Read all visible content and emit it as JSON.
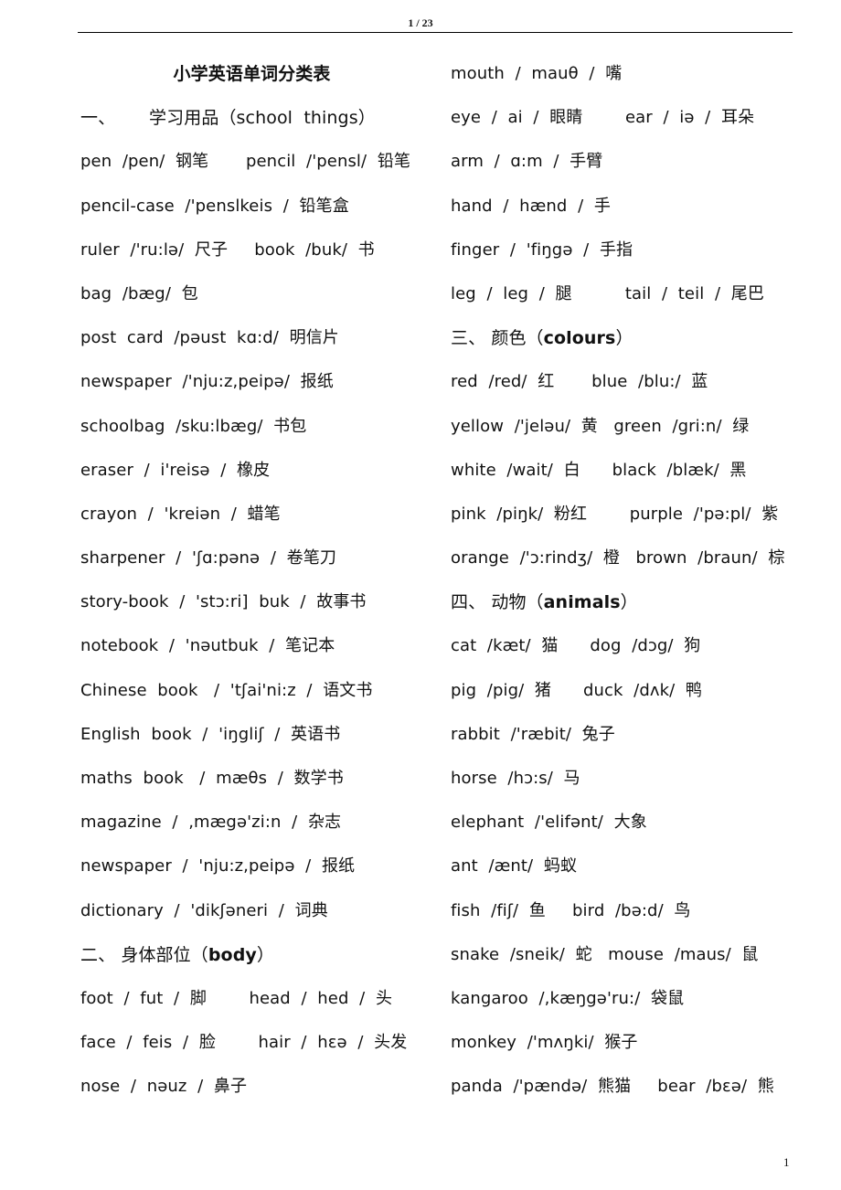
{
  "header": {
    "page_indicator": "1 / 23"
  },
  "footer": {
    "page_number": "1"
  },
  "left_column": [
    {
      "type": "title",
      "text": "小学英语单词分类表"
    },
    {
      "type": "heading",
      "prefix": "一、      学习用品（",
      "en": "school  things",
      "suffix": "）",
      "bold_en": false
    },
    {
      "type": "entry",
      "text": "pen  /pen/  钢笔       pencil  /'pensl/  铅笔"
    },
    {
      "type": "entry",
      "text": "pencil-case  /'penslkeis  /  铅笔盒"
    },
    {
      "type": "entry",
      "text": "ruler  /'ru:lə/  尺子     book  /buk/  书"
    },
    {
      "type": "entry",
      "text": "bag  /bæg/  包"
    },
    {
      "type": "entry",
      "text": "post  card  /pəust  kɑ:d/  明信片"
    },
    {
      "type": "entry",
      "text": "newspaper  /'nju:z,peipə/  报纸"
    },
    {
      "type": "entry",
      "text": "schoolbag  /sku:lbæg/  书包"
    },
    {
      "type": "entry",
      "text": "eraser  /  i'reisə  /  橡皮"
    },
    {
      "type": "entry",
      "text": "crayon  /  'kreiən  /  蜡笔"
    },
    {
      "type": "entry",
      "text": "sharpener  /  'ʃɑ:pənə  /  卷笔刀"
    },
    {
      "type": "entry",
      "text": "story-book  /  'stɔ:ri]  buk  /  故事书"
    },
    {
      "type": "entry",
      "text": "notebook  /  'nəutbuk  /  笔记本"
    },
    {
      "type": "entry",
      "text": "Chinese  book   /  'tʃai'ni:z  /  语文书"
    },
    {
      "type": "entry",
      "text": "English  book  /  'iŋgliʃ  /  英语书"
    },
    {
      "type": "entry",
      "text": "maths  book   /  mæθs  /  数学书"
    },
    {
      "type": "entry",
      "text": "magazine  /  ,mægə'zi:n  /  杂志"
    },
    {
      "type": "entry",
      "text": "newspaper  /  'nju:z,peipə  /  报纸"
    },
    {
      "type": "entry",
      "text": "dictionary  /  'dikʃəneri  /  词典"
    },
    {
      "type": "heading",
      "prefix": "二、 身体部位（",
      "en": "body",
      "suffix": "）",
      "bold_en": true
    },
    {
      "type": "entry",
      "text": "foot  /  fut  /  脚        head  /  hed  /  头"
    },
    {
      "type": "entry",
      "text": "face  /  feis  /  脸        hair  /  hɛə  /  头发"
    },
    {
      "type": "entry",
      "text": "nose  /  nəuz  /  鼻子"
    }
  ],
  "right_column": [
    {
      "type": "entry",
      "text": "mouth  /  mauθ  /  嘴"
    },
    {
      "type": "entry",
      "text": "eye  /  ai  /  眼睛        ear  /  iə  /  耳朵"
    },
    {
      "type": "entry",
      "text": "arm  /  ɑ:m  /  手臂"
    },
    {
      "type": "entry",
      "text": "hand  /  hænd  /  手"
    },
    {
      "type": "entry",
      "text": "finger  /  'fiŋgə  /  手指"
    },
    {
      "type": "entry",
      "text": "leg  /  leg  /  腿          tail  /  teil  /  尾巴"
    },
    {
      "type": "heading",
      "prefix": "三、 颜色（",
      "en": "colours",
      "suffix": "）",
      "bold_en": true
    },
    {
      "type": "entry",
      "text": "red  /red/  红       blue  /blu:/  蓝"
    },
    {
      "type": "entry",
      "text": "yellow  /'jeləu/  黄   green  /gri:n/  绿"
    },
    {
      "type": "entry",
      "text": "white  /wait/  白      black  /blæk/  黑"
    },
    {
      "type": "entry",
      "text": "pink  /piŋk/  粉红        purple  /'pə:pl/  紫"
    },
    {
      "type": "entry",
      "text": "orange  /'ɔ:rindʒ/  橙   brown  /braun/  棕"
    },
    {
      "type": "heading",
      "prefix": "四、 动物（",
      "en": "animals",
      "suffix": "）",
      "bold_en": true
    },
    {
      "type": "entry",
      "text": "cat  /kæt/  猫      dog  /dɔg/  狗"
    },
    {
      "type": "entry",
      "text": "pig  /pig/  猪      duck  /dʌk/  鸭"
    },
    {
      "type": "entry",
      "text": "rabbit  /'ræbit/  兔子"
    },
    {
      "type": "entry",
      "text": "horse  /hɔ:s/  马"
    },
    {
      "type": "entry",
      "text": "elephant  /'elifənt/  大象"
    },
    {
      "type": "entry",
      "text": "ant  /ænt/  蚂蚁"
    },
    {
      "type": "entry",
      "text": "fish  /fiʃ/  鱼     bird  /bə:d/  鸟"
    },
    {
      "type": "entry",
      "text": "snake  /sneik/  蛇   mouse  /maus/  鼠"
    },
    {
      "type": "entry",
      "text": "kangaroo  /,kæŋgə'ru:/  袋鼠"
    },
    {
      "type": "entry",
      "text": "monkey  /'mʌŋki/  猴子"
    },
    {
      "type": "entry",
      "text": "panda  /'pændə/  熊猫     bear  /bɛə/  熊"
    }
  ]
}
